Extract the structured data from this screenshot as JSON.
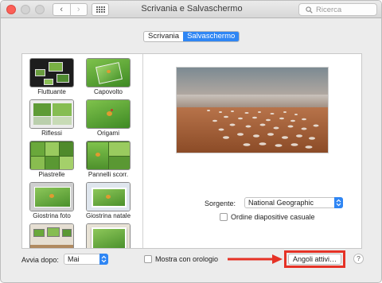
{
  "window": {
    "title": "Scrivania e Salvaschermo",
    "search_placeholder": "Ricerca"
  },
  "tabs": [
    {
      "label": "Scrivania",
      "active": false
    },
    {
      "label": "Salvaschermo",
      "active": true
    }
  ],
  "screensavers": [
    {
      "label": "Fluttuante",
      "selected": false
    },
    {
      "label": "Capovolto",
      "selected": false
    },
    {
      "label": "Riflessi",
      "selected": false
    },
    {
      "label": "Origami",
      "selected": false
    },
    {
      "label": "Piastrelle",
      "selected": false
    },
    {
      "label": "Pannelli scorr.",
      "selected": false
    },
    {
      "label": "Giostrina foto",
      "selected": false
    },
    {
      "label": "Giostrina natale",
      "selected": false
    },
    {
      "label": "",
      "selected": false
    },
    {
      "label": "",
      "selected": false
    }
  ],
  "options": {
    "source_label": "Sorgente:",
    "source_value": "National Geographic",
    "shuffle_label": "Ordine diapositive casuale",
    "shuffle_checked": false
  },
  "footer": {
    "start_after_label": "Avvia dopo:",
    "start_after_value": "Mai",
    "show_clock_label": "Mostra con orologio",
    "show_clock_checked": false,
    "hot_corners_label": "Angoli attivi…",
    "help_label": "?"
  },
  "colors": {
    "accent": "#2f86f4",
    "highlight": "#e53226",
    "close": "#fc5f57"
  }
}
